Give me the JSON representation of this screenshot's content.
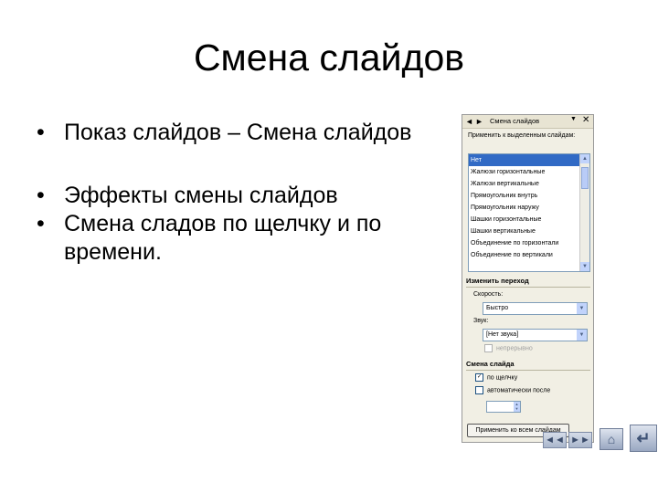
{
  "slide": {
    "title": "Смена слайдов",
    "bullets": [
      "Показ слайдов – Смена слайдов",
      "Эффекты смены слайдов",
      "Смена сладов по щелчку и по времени."
    ],
    "bullet_glyph": "•"
  },
  "pane": {
    "back": "◄",
    "forward": "►",
    "title": "Смена слайдов",
    "menu_arrow": "▼",
    "close": "✕",
    "apply_label": "Применить к выделенным слайдам:",
    "transitions": [
      "Нет",
      "Жалюзи горизонтальные",
      "Жалюзи вертикальные",
      "Прямоугольник внутрь",
      "Прямоугольник наружу",
      "Шашки горизонтальные",
      "Шашки вертикальные",
      "Объединение по горизонтали",
      "Объединение по вертикали"
    ],
    "selected_transition": "Нет",
    "scroll_up": "▲",
    "scroll_down": "▼",
    "modify_section": "Изменить переход",
    "speed_label": "Скорость:",
    "speed_value": "Быстро",
    "sound_label": "Звук:",
    "sound_value": "[Нет звука]",
    "combo_arrow": "▼",
    "loop_label": "непрерывно",
    "advance_section": "Смена слайда",
    "on_click_label": "по щелчку",
    "on_click_checked": true,
    "auto_label": "автоматически после",
    "auto_checked": false,
    "checkmark": "✓",
    "spin_up": "▲",
    "spin_down": "▼",
    "apply_all": "Применить ко всем слайдам"
  },
  "nav": {
    "prev": "◄◄",
    "next": "►►",
    "home": "⌂",
    "return": "↵"
  }
}
